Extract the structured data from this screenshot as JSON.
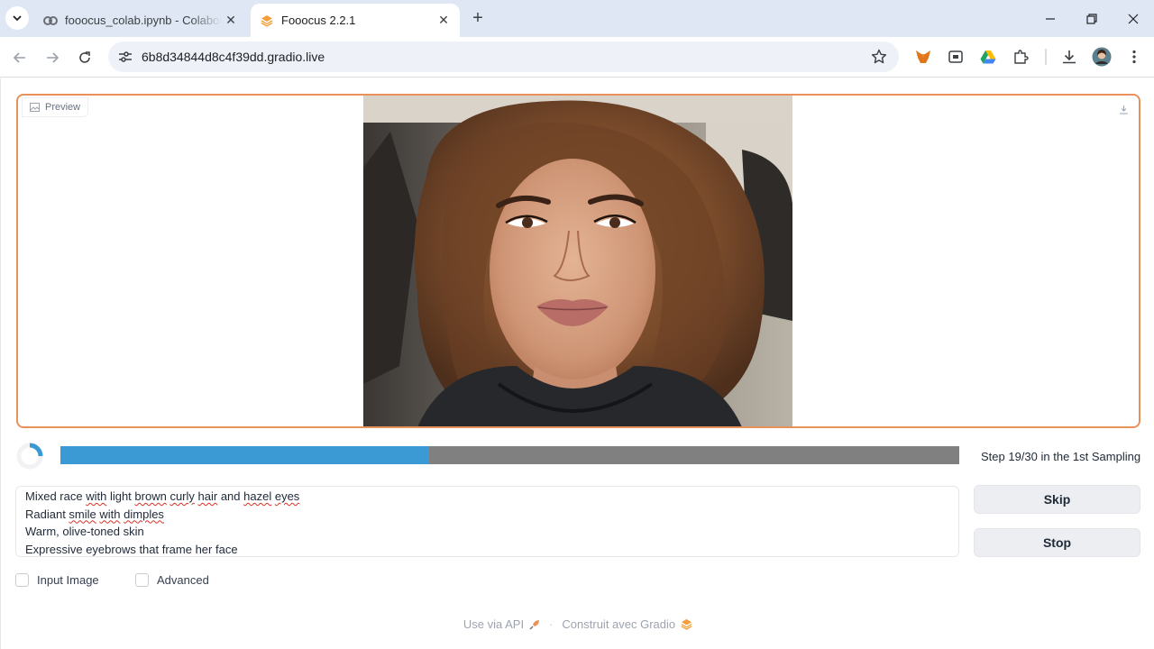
{
  "browser": {
    "tabs": [
      {
        "title": "fooocus_colab.ipynb - Colaboratory",
        "favicon": "colab-icon",
        "active": false
      },
      {
        "title": "Fooocus 2.2.1",
        "favicon": "gradio-icon",
        "active": true
      }
    ],
    "url": "6b8d34844d8c4f39dd.gradio.live",
    "extensions": [
      "metamask-fox-icon",
      "wallet-icon",
      "google-drive-icon",
      "extensions-puzzle-icon"
    ],
    "accent": "#dfe7f5"
  },
  "preview": {
    "label": "Preview",
    "border_color": "#e8915b"
  },
  "progress": {
    "fraction": 0.41,
    "text": "Step 19/30 in the 1st Sampling",
    "fill_color": "#3b9ad4",
    "track_color": "#808080"
  },
  "prompt": {
    "lines": [
      "Mixed race with light brown curly hair and hazel eyes",
      "Radiant smile with dimples",
      "Warm, olive-toned skin",
      "Expressive eyebrows that frame her face"
    ]
  },
  "buttons": {
    "skip": "Skip",
    "stop": "Stop"
  },
  "options": {
    "input_image": "Input Image",
    "advanced": "Advanced"
  },
  "footer": {
    "api": "Use via API",
    "separator": "·",
    "built_with": "Construit avec Gradio"
  }
}
